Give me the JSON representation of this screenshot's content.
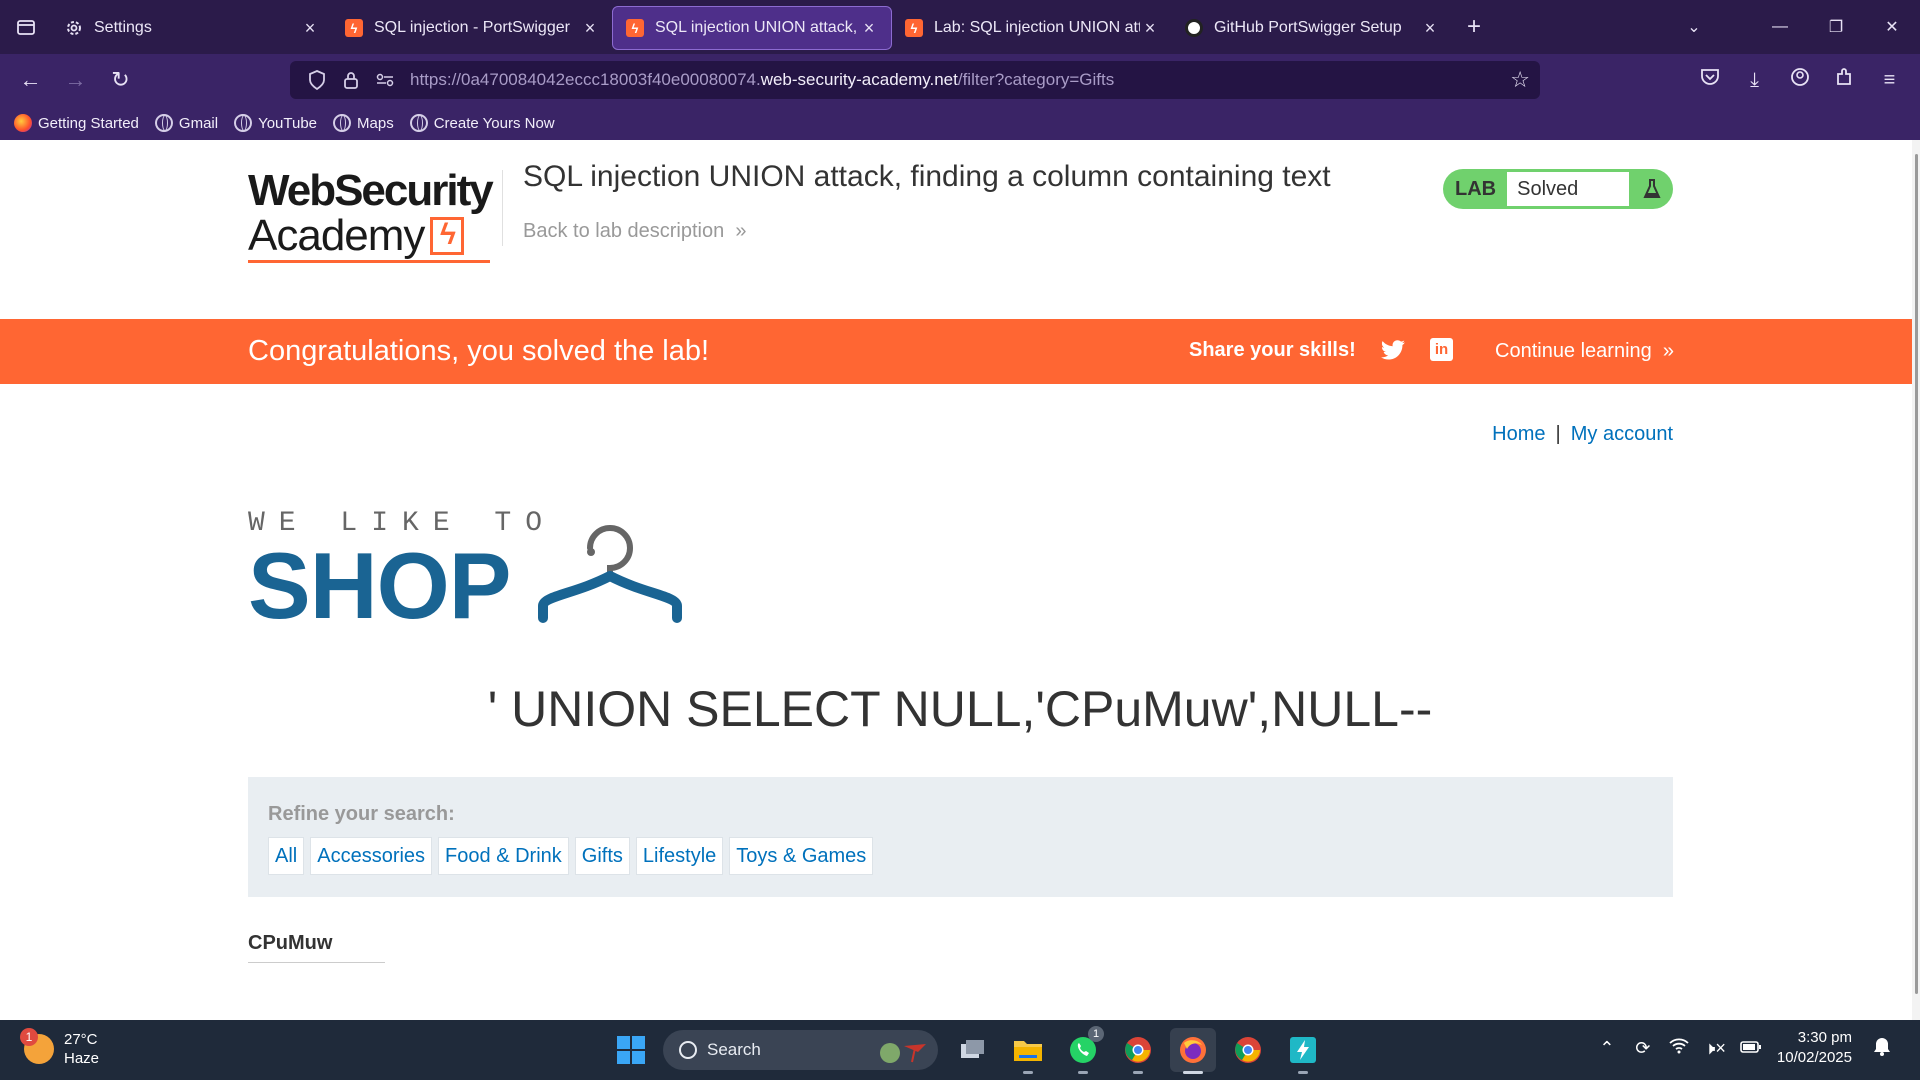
{
  "browser": {
    "tabs": [
      {
        "label": "Settings",
        "icon": "gear-icon",
        "active": false
      },
      {
        "label": "SQL injection - PortSwigger",
        "icon": "portswigger-icon",
        "active": false
      },
      {
        "label": "SQL injection UNION attack, fin",
        "icon": "portswigger-icon",
        "active": true
      },
      {
        "label": "Lab: SQL injection UNION attac",
        "icon": "portswigger-icon",
        "active": false
      },
      {
        "label": "GitHub PortSwigger Setup",
        "icon": "github-icon",
        "active": false
      }
    ],
    "url_prefix": "https://0a470084042eccc18003f40e00080074.",
    "url_domain": "web-security-academy.net",
    "url_path": "/filter?category=Gifts",
    "bookmarks": [
      "Getting Started",
      "Gmail",
      "YouTube",
      "Maps",
      "Create Yours Now"
    ]
  },
  "header": {
    "logo_line1": "WebSecurity",
    "logo_line2": "Academy",
    "lab_title": "SQL injection UNION attack, finding a column containing text",
    "back_link": "Back to lab description",
    "badge_lab": "LAB",
    "badge_status": "Solved"
  },
  "banner": {
    "message": "Congratulations, you solved the lab!",
    "share": "Share your skills!",
    "continue": "Continue learning"
  },
  "nav": {
    "home": "Home",
    "separator": "|",
    "account": "My account"
  },
  "shop": {
    "tagline": "WE LIKE TO",
    "name": "SHOP"
  },
  "search_heading": "' UNION SELECT NULL,'CPuMuw',NULL--",
  "refine": {
    "title": "Refine your search:",
    "filters": [
      "All",
      "Accessories",
      "Food & Drink",
      "Gifts",
      "Lifestyle",
      "Toys & Games"
    ]
  },
  "results": [
    "CPuMuw"
  ],
  "taskbar": {
    "weather_temp": "27°C",
    "weather_desc": "Haze",
    "weather_badge": "1",
    "search_placeholder": "Search",
    "whatsapp_badge": "1",
    "time": "3:30 pm",
    "date": "10/02/2025"
  },
  "colors": {
    "accent_orange": "#ff6633",
    "link_blue": "#0071bc",
    "shop_blue": "#1a6493",
    "lab_green": "#70d16d",
    "browser_purple": "#3a2466"
  }
}
